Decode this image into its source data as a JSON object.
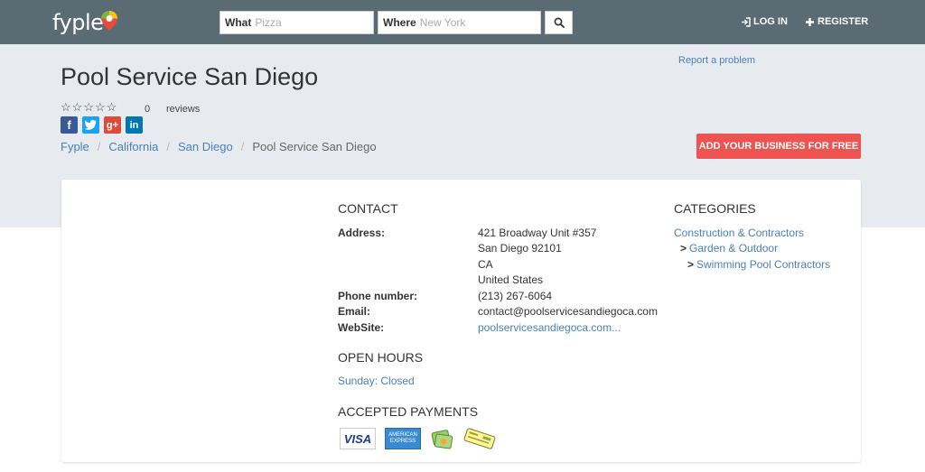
{
  "header": {
    "logo": "fyple",
    "what_label": "What",
    "what_placeholder": "Pizza",
    "where_label": "Where",
    "where_placeholder": "New York",
    "login": "LOG IN",
    "register": "REGISTER",
    "colors": {
      "bar": "#5b6b73",
      "pin_red": "#e84a3c",
      "pin_yellow": "#f5c518",
      "pin_green": "#7cb342"
    }
  },
  "business": {
    "name": "Pool Service San Diego",
    "report": "Report a problem",
    "rating_stars": 0,
    "reviews_count": "0",
    "reviews_label": "reviews",
    "social": [
      {
        "name": "facebook",
        "glyph": "f",
        "color": "#3b5998"
      },
      {
        "name": "twitter",
        "glyph": "t",
        "color": "#1da1f2"
      },
      {
        "name": "google-plus",
        "glyph": "g+",
        "color": "#dd4b39"
      },
      {
        "name": "linkedin",
        "glyph": "in",
        "color": "#0077b5"
      }
    ],
    "add_button": "ADD YOUR BUSINESS FOR FREE",
    "add_button_color": "#ef5350"
  },
  "breadcrumb": {
    "items": [
      "Fyple",
      "California",
      "San Diego"
    ],
    "current": "Pool Service San Diego"
  },
  "contact": {
    "title": "CONTACT",
    "address_label": "Address:",
    "address_lines": [
      "421 Broadway Unit #357",
      "San Diego 92101",
      "CA",
      "United States"
    ],
    "phone_label": "Phone number:",
    "phone": "(213) 267-6064",
    "email_label": "Email:",
    "email": "contact@poolservicesandiegoca.com",
    "website_label": "WebSite:",
    "website": "poolservicesandiegoca.com..."
  },
  "hours": {
    "title": "OPEN HOURS",
    "entries": [
      "Sunday: Closed"
    ]
  },
  "payments": {
    "title": "ACCEPTED PAYMENTS",
    "methods": [
      "VISA",
      "AMERICAN EXPRESS",
      "cash",
      "check"
    ]
  },
  "categories": {
    "title": "CATEGORIES",
    "items": [
      "Construction & Contractors",
      "Garden & Outdoor",
      "Swimming Pool Contractors"
    ],
    "arrow": ">"
  },
  "icons": {
    "search": "search-icon",
    "login": "login-icon",
    "register": "plus-icon",
    "star": "star-outline-icon"
  }
}
